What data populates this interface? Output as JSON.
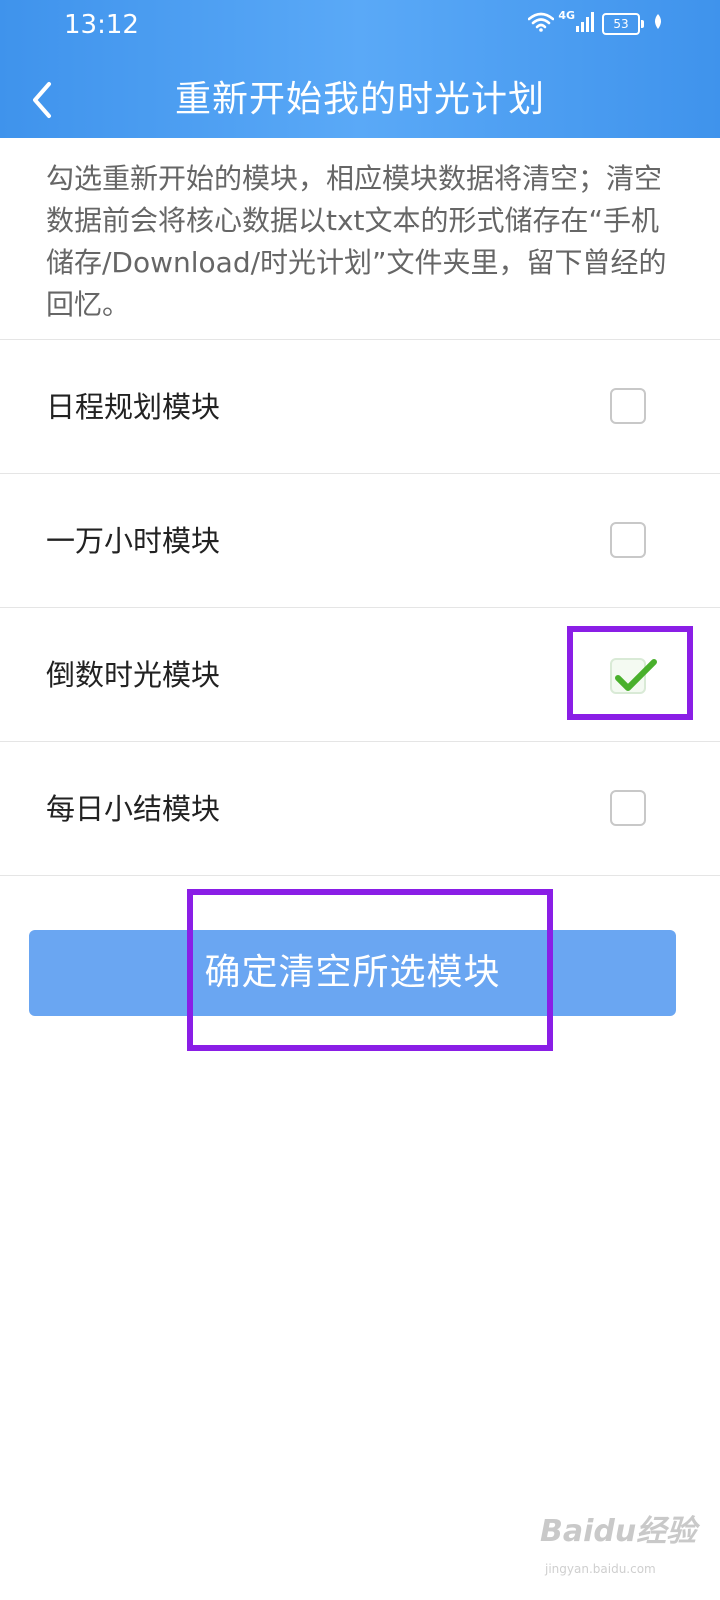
{
  "status_bar": {
    "time": "13:12",
    "network_type": "4G",
    "battery_level": "53",
    "icons": [
      "wifi-icon",
      "signal-icon",
      "battery-icon",
      "leaf-icon"
    ]
  },
  "header": {
    "title": "重新开始我的时光计划",
    "back_icon": "chevron-left-icon"
  },
  "description": "勾选重新开始的模块，相应模块数据将清空；清空数据前会将核心数据以txt文本的形式储存在“手机储存/Download/时光计划”文件夹里，留下曾经的回忆。",
  "modules": [
    {
      "label": "日程规划模块",
      "checked": false
    },
    {
      "label": "一万小时模块",
      "checked": false
    },
    {
      "label": "倒数时光模块",
      "checked": true
    },
    {
      "label": "每日小结模块",
      "checked": false
    }
  ],
  "confirm_button": {
    "label": "确定清空所选模块"
  },
  "watermark": {
    "logo_text": "Baidu经验",
    "url_text": "jingyan.baidu.com"
  },
  "colors": {
    "header_blue": "#4a9cf0",
    "button_blue": "#6aa6f2",
    "highlight_purple": "#8a1ee6",
    "check_green": "#49b02c"
  }
}
